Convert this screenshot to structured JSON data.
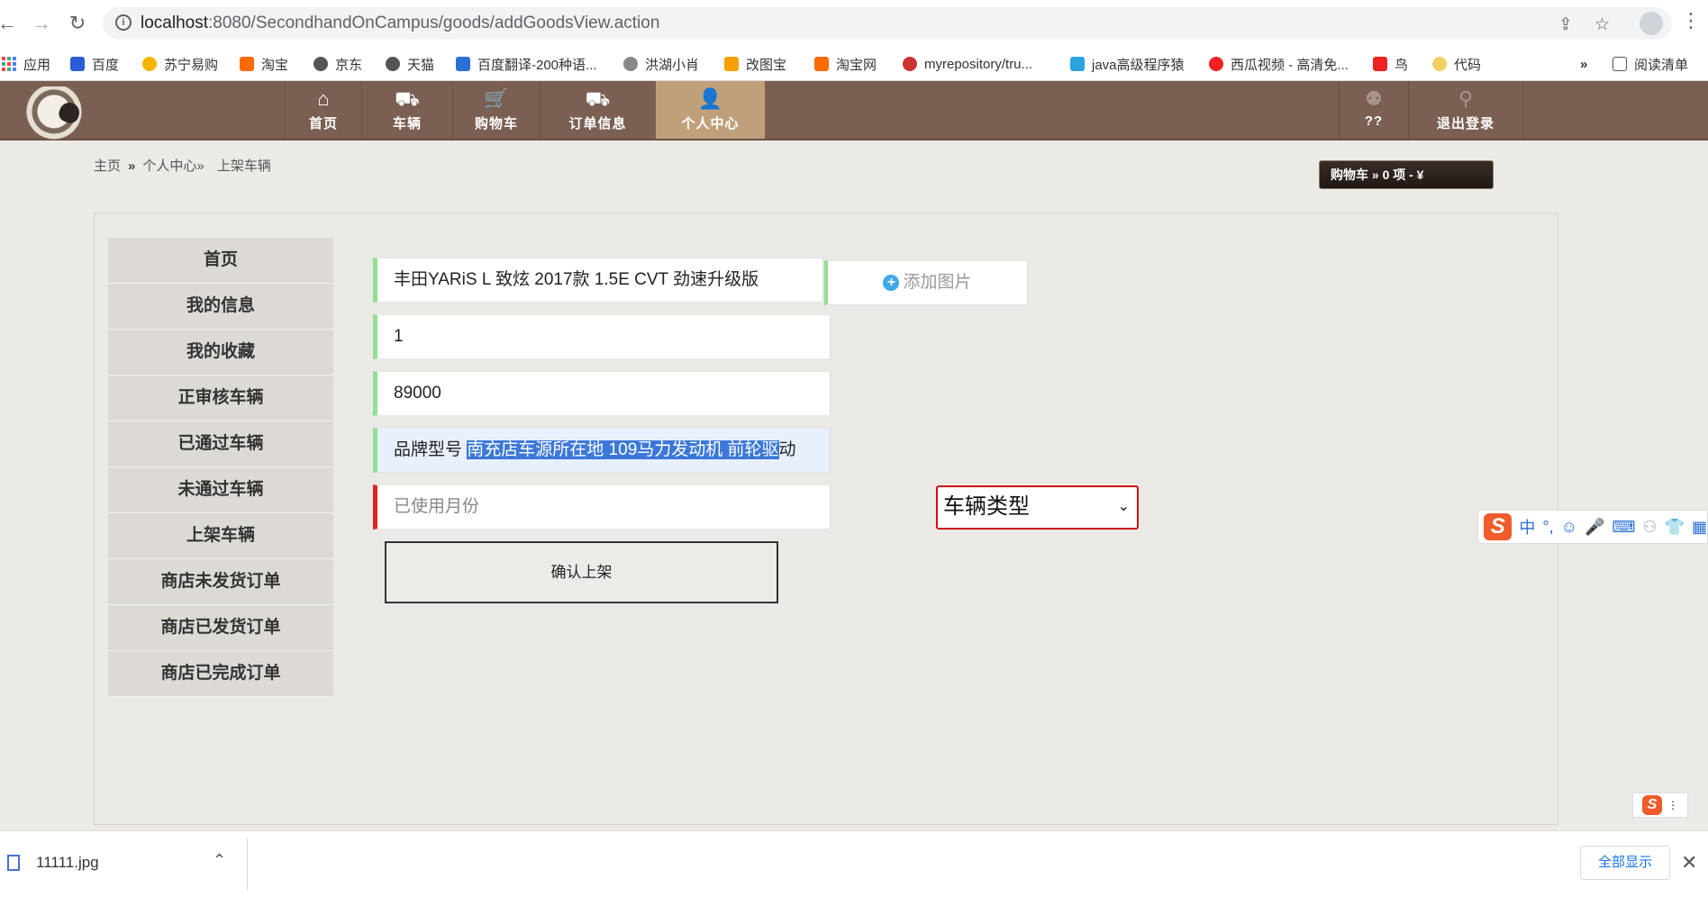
{
  "browser": {
    "url_host": "localhost",
    "url_rest": ":8080/SecondhandOnCampus/goods/addGoodsView.action",
    "bookmarks": [
      {
        "label": "应用",
        "color": "#e44"
      },
      {
        "label": "百度",
        "color": "#2a5cd6"
      },
      {
        "label": "苏宁易购",
        "color": "#f2b600"
      },
      {
        "label": "淘宝",
        "color": "#ff6a00"
      },
      {
        "label": "京东",
        "color": "#555"
      },
      {
        "label": "天猫",
        "color": "#555"
      },
      {
        "label": "百度翻译-200种语...",
        "color": "#2a6fd6"
      },
      {
        "label": "洪湖小肖",
        "color": "#888"
      },
      {
        "label": "改图宝",
        "color": "#f5a000"
      },
      {
        "label": "淘宝网",
        "color": "#ff6a00"
      },
      {
        "label": "myrepository/tru...",
        "color": "#c33"
      },
      {
        "label": "java高级程序猿",
        "color": "#2aa3e0"
      },
      {
        "label": "西瓜视频 - 高清免...",
        "color": "#e22"
      },
      {
        "label": "鸟",
        "color": "#e22"
      },
      {
        "label": "代码",
        "color": "#f0d060"
      }
    ],
    "more_bookmarks": "»",
    "reading_list": "阅读清单"
  },
  "header": {
    "menu": [
      {
        "label": "首页",
        "icon": "home-icon",
        "glyph": "⌂"
      },
      {
        "label": "车辆",
        "icon": "basket-icon",
        "glyph": "⛟"
      },
      {
        "label": "购物车",
        "icon": "cart-icon",
        "glyph": "🛒"
      },
      {
        "label": "订单信息",
        "icon": "truck-icon",
        "glyph": "⛟"
      },
      {
        "label": "个人中心",
        "icon": "user-add-icon",
        "glyph": "👤"
      }
    ],
    "right_menu": [
      {
        "label": "??",
        "icon": "group-icon",
        "glyph": "⚉"
      },
      {
        "label": "退出登录",
        "icon": "pin-icon",
        "glyph": "⚲"
      }
    ]
  },
  "breadcrumb": {
    "home": "主页",
    "sep": "»",
    "center": "个人中心»",
    "current": "上架车辆"
  },
  "cart": {
    "text": "购物车  » 0 项 - ¥"
  },
  "sidebar": {
    "items": [
      "首页",
      "我的信息",
      "我的收藏",
      "正审核车辆",
      "已通过车辆",
      "未通过车辆",
      "上架车辆",
      "商店未发货订单",
      "商店已发货订单",
      "商店已完成订单"
    ]
  },
  "form": {
    "name_value": "丰田YARiS L 致炫 2017款 1.5E CVT 劲速升级版",
    "add_image": "添加图片",
    "quantity_value": "1",
    "price_value": "89000",
    "desc_prefix": "品牌型号 ",
    "desc_selected": "南充店车源所在地 109马力发动机 前轮驱",
    "desc_suffix": "动",
    "months_placeholder": "已使用月份",
    "type_select": "车辆类型",
    "submit": "确认上架"
  },
  "ime": {
    "logo": "S",
    "mode": "中",
    "punct": "°,"
  },
  "download": {
    "file": "11111.jpg",
    "show_all": "全部显示"
  }
}
